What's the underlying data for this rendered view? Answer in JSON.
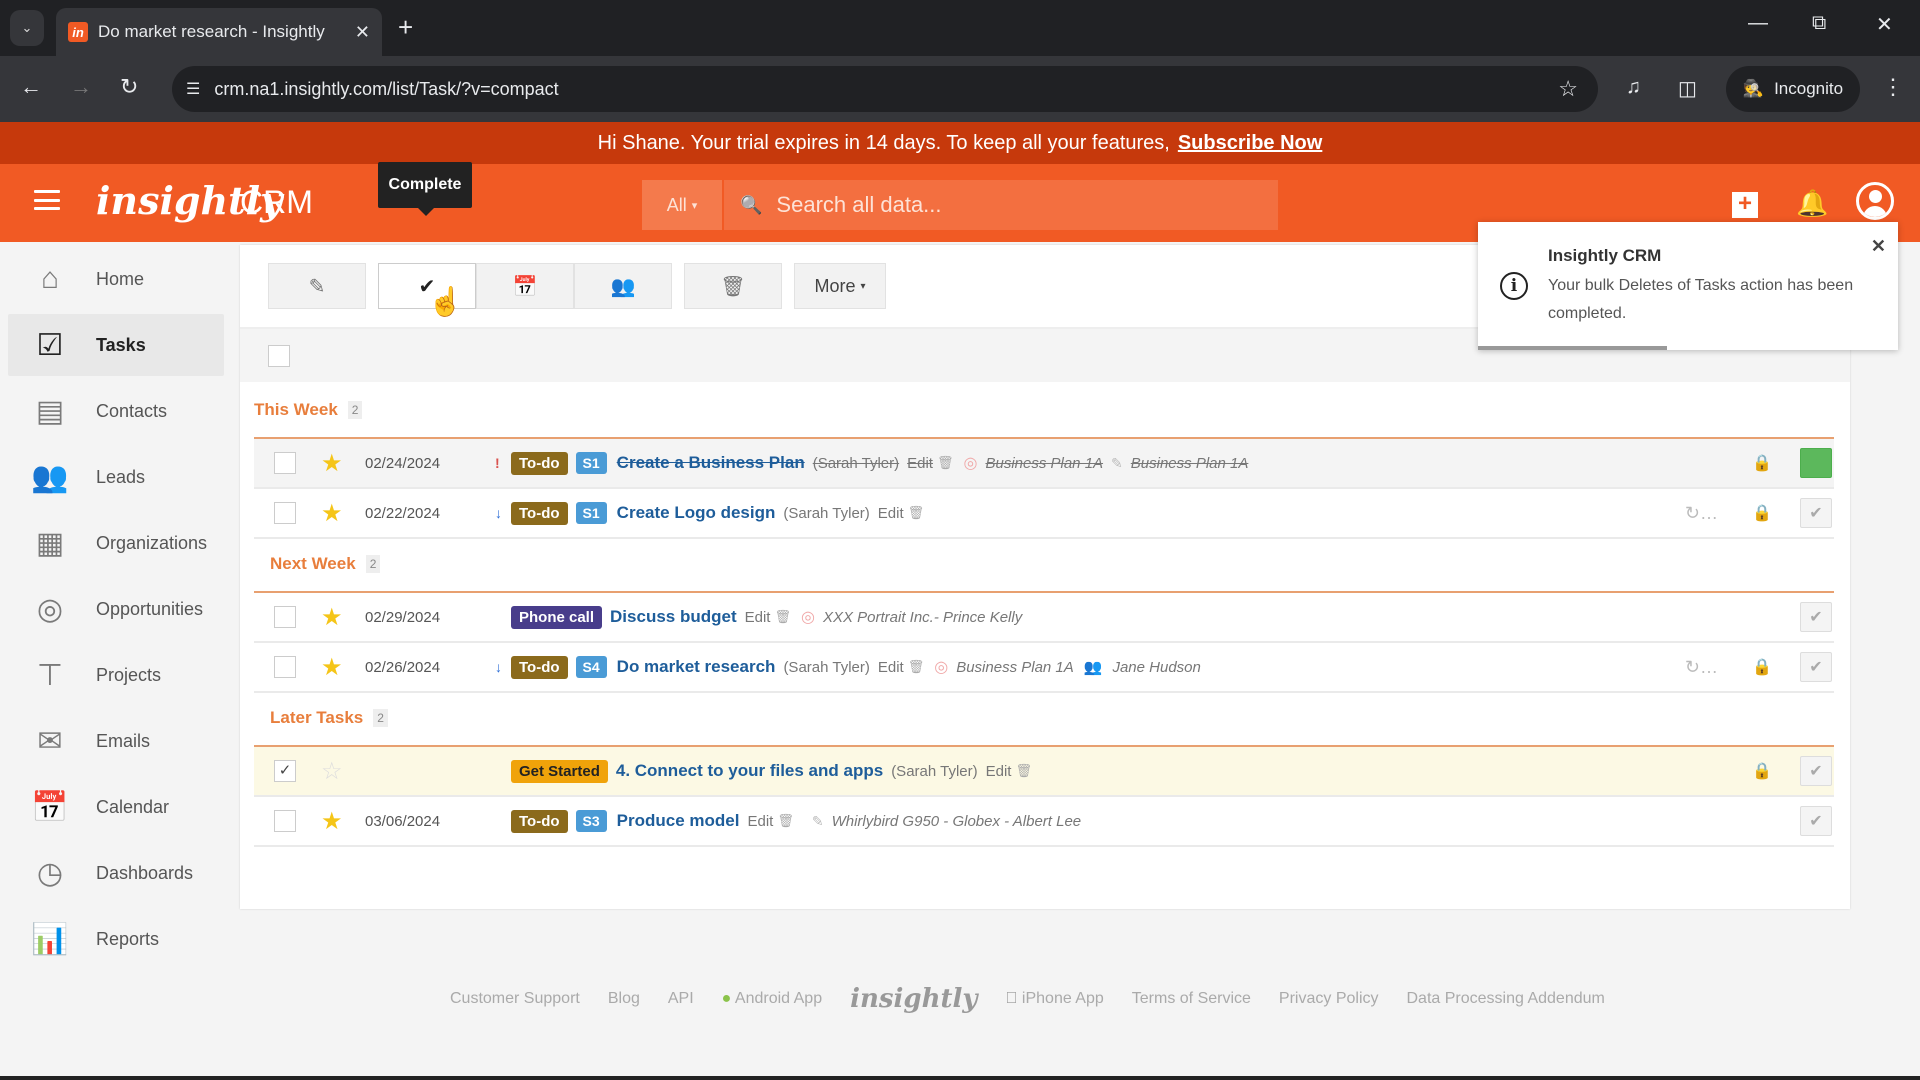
{
  "browser": {
    "tab_title": "Do market research - Insightly",
    "favicon_text": "in",
    "url": "crm.na1.insightly.com/list/Task/?v=compact",
    "profile_label": "Incognito"
  },
  "banner": {
    "text": "Hi Shane. Your trial expires in 14 days. To keep all your features,",
    "link": "Subscribe Now"
  },
  "header": {
    "logo": "insightly",
    "product": "CRM",
    "tooltip": "Complete",
    "search_scope": "All",
    "search_placeholder": "Search all data..."
  },
  "sidebar": {
    "items": [
      {
        "label": "Home",
        "icon": "home-icon",
        "active": false
      },
      {
        "label": "Tasks",
        "icon": "tasks-icon",
        "active": true
      },
      {
        "label": "Contacts",
        "icon": "contacts-icon",
        "active": false
      },
      {
        "label": "Leads",
        "icon": "leads-icon",
        "active": false
      },
      {
        "label": "Organizations",
        "icon": "organizations-icon",
        "active": false
      },
      {
        "label": "Opportunities",
        "icon": "opportunities-icon",
        "active": false
      },
      {
        "label": "Projects",
        "icon": "projects-icon",
        "active": false
      },
      {
        "label": "Emails",
        "icon": "emails-icon",
        "active": false
      },
      {
        "label": "Calendar",
        "icon": "calendar-icon",
        "active": false
      },
      {
        "label": "Dashboards",
        "icon": "dashboards-icon",
        "active": false
      },
      {
        "label": "Reports",
        "icon": "reports-icon",
        "active": false
      }
    ]
  },
  "actions": {
    "edit": "edit-icon",
    "complete": "check-icon",
    "reschedule": "calendar-icon",
    "assign": "assign-users-icon",
    "delete": "trash-icon",
    "more_label": "More"
  },
  "groups": [
    {
      "title": "This Week",
      "count": "2",
      "tasks": [
        {
          "date": "02/24/2024",
          "priority": "high",
          "type": "To-do",
          "stage": "S1",
          "title": "Create a Business Plan",
          "owner": "(Sarah Tyler)",
          "edit": "Edit",
          "related_opportunity": "Business Plan 1A",
          "related_project": "Business Plan 1A",
          "completed": true,
          "starred": true,
          "checked": false,
          "recurring": false,
          "private": true
        },
        {
          "date": "02/22/2024",
          "priority": "low",
          "type": "To-do",
          "stage": "S1",
          "title": "Create Logo design",
          "owner": "(Sarah Tyler)",
          "edit": "Edit",
          "completed": false,
          "starred": true,
          "checked": false,
          "recurring": true,
          "private": true
        }
      ]
    },
    {
      "title": "Next Week",
      "count": "2",
      "tasks": [
        {
          "date": "02/29/2024",
          "priority": "",
          "type": "Phone call",
          "stage": "",
          "title": "Discuss budget",
          "owner": "",
          "edit": "Edit",
          "related_opportunity": "XXX Portrait Inc.- Prince Kelly",
          "completed": false,
          "starred": true,
          "checked": false,
          "recurring": false,
          "private": false
        },
        {
          "date": "02/26/2024",
          "priority": "low",
          "type": "To-do",
          "stage": "S4",
          "title": "Do market research",
          "owner": "(Sarah Tyler)",
          "edit": "Edit",
          "related_opportunity": "Business Plan 1A",
          "related_contact": "Jane Hudson",
          "completed": false,
          "starred": true,
          "checked": false,
          "recurring": true,
          "private": true
        }
      ]
    },
    {
      "title": "Later Tasks",
      "count": "2",
      "tasks": [
        {
          "date": "",
          "priority": "",
          "type": "Get Started",
          "stage": "",
          "title": "4. Connect to your files and apps",
          "owner": "(Sarah Tyler)",
          "edit": "Edit",
          "completed": false,
          "starred": false,
          "checked": true,
          "recurring": false,
          "private": true
        },
        {
          "date": "03/06/2024",
          "priority": "",
          "type": "To-do",
          "stage": "S3",
          "title": "Produce model",
          "owner": "",
          "edit": "Edit",
          "related_project": "Whirlybird G950 - Globex - Albert Lee",
          "completed": false,
          "starred": true,
          "checked": false,
          "recurring": false,
          "private": false
        }
      ]
    }
  ],
  "toast": {
    "title": "Insightly CRM",
    "message": "Your bulk Deletes of Tasks action has been completed.",
    "progress": 0.45
  },
  "footer": {
    "links": [
      "Customer Support",
      "Blog",
      "API",
      "Android App"
    ],
    "logo": "insightly",
    "links_right": [
      "iPhone App",
      "Terms of Service",
      "Privacy Policy",
      "Data Processing Addendum"
    ]
  },
  "colors": {
    "brand": "#f15a24",
    "banner": "#c6390c",
    "todo": "#8b6a1c",
    "phone_call": "#483d8b",
    "get_started": "#f0a30a",
    "stage": "#4a9bd6",
    "complete_done": "#5cb85c"
  }
}
